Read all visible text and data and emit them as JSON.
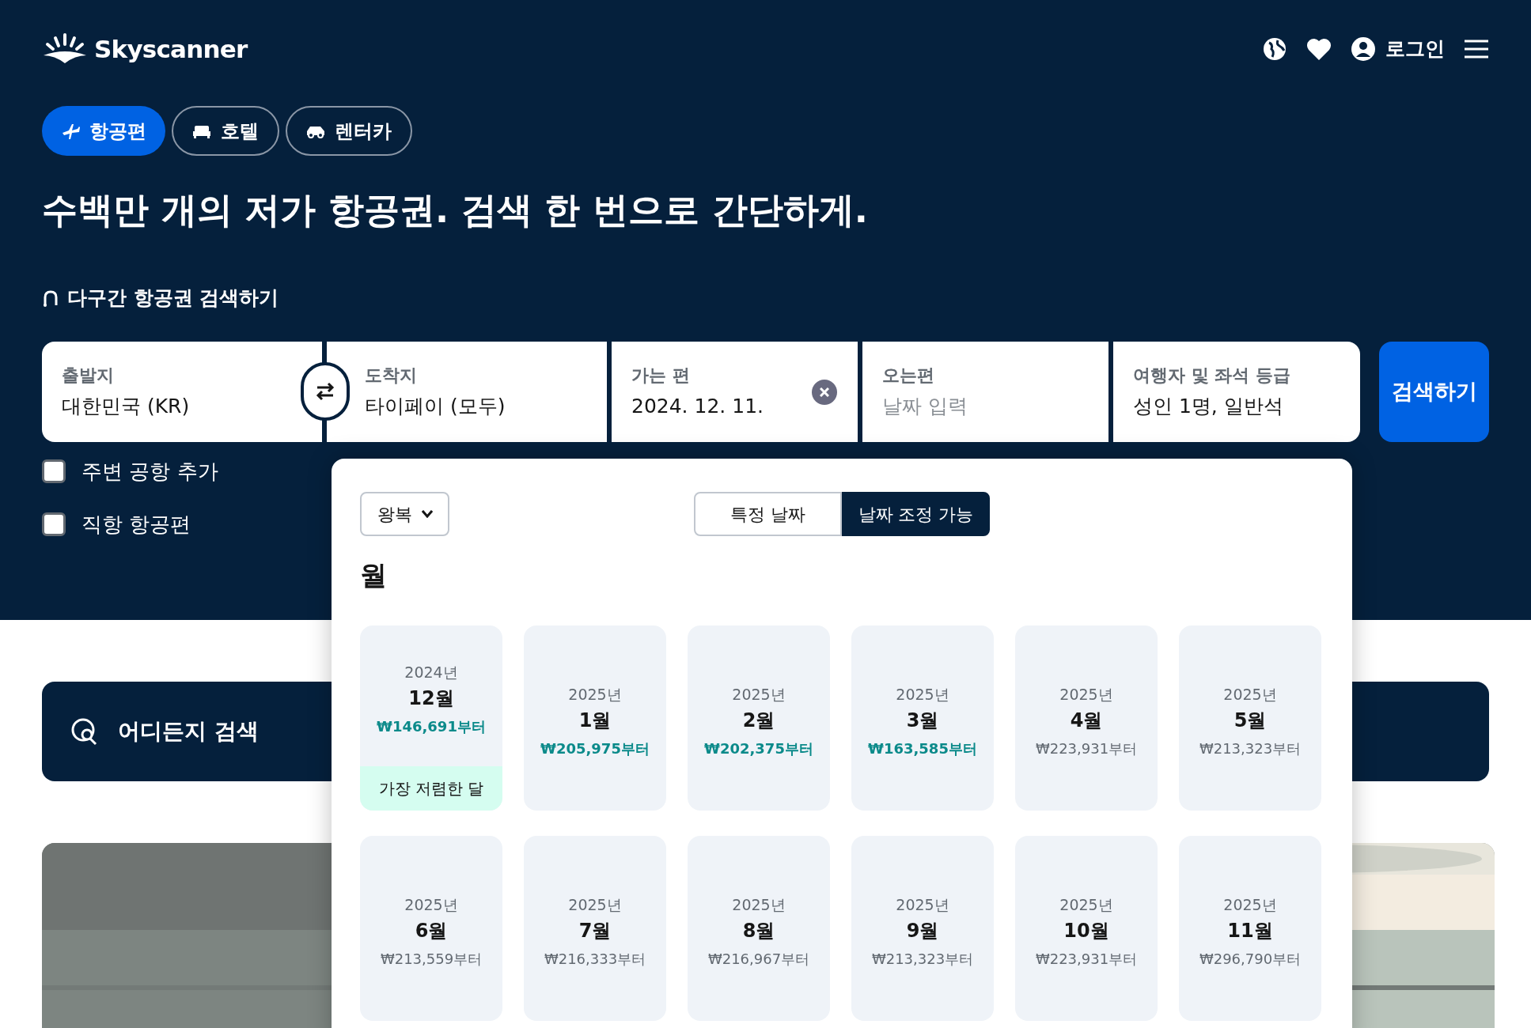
{
  "header": {
    "logo": "Skyscanner",
    "login": "로그인"
  },
  "tabs": [
    {
      "label": "항공편",
      "kind": "flights",
      "selected": true
    },
    {
      "label": "호텔",
      "kind": "hotels",
      "selected": false
    },
    {
      "label": "렌터카",
      "kind": "cars",
      "selected": false
    }
  ],
  "headline": "수백만 개의 저가 항공권. 검색 한 번으로 간단하게.",
  "multi_city": "다구간 항공권 검색하기",
  "search": {
    "fields": [
      {
        "label": "출발지",
        "value": "대한민국 (KR)"
      },
      {
        "label": "도착지",
        "value": "타이페이 (모두)"
      },
      {
        "label": "가는 편",
        "value": "2024. 12. 11."
      },
      {
        "label": "오는편",
        "placeholder": "날짜 입력"
      },
      {
        "label": "여행자 및 좌석 등급",
        "value": "성인 1명, 일반석"
      }
    ],
    "button": "검색하기"
  },
  "options": [
    {
      "label": "주변 공항 추가",
      "checked": false
    },
    {
      "label": "직항 항공편",
      "checked": false
    }
  ],
  "anywhere": "어디든지 검색",
  "date_popup": {
    "trip_type": "왕복",
    "modes": [
      {
        "label": "특정 날짜",
        "selected": false
      },
      {
        "label": "날짜 조정 가능",
        "selected": true
      }
    ],
    "heading": "월",
    "months": [
      {
        "year": "2024년",
        "month": "12월",
        "price": "₩146,691부터",
        "highlight": true,
        "badge": "가장 저렴한 달"
      },
      {
        "year": "2025년",
        "month": "1월",
        "price": "₩205,975부터",
        "highlight": true
      },
      {
        "year": "2025년",
        "month": "2월",
        "price": "₩202,375부터",
        "highlight": true
      },
      {
        "year": "2025년",
        "month": "3월",
        "price": "₩163,585부터",
        "highlight": true
      },
      {
        "year": "2025년",
        "month": "4월",
        "price": "₩223,931부터",
        "highlight": false
      },
      {
        "year": "2025년",
        "month": "5월",
        "price": "₩213,323부터",
        "highlight": false
      },
      {
        "year": "2025년",
        "month": "6월",
        "price": "₩213,559부터",
        "highlight": false
      },
      {
        "year": "2025년",
        "month": "7월",
        "price": "₩216,333부터",
        "highlight": false
      },
      {
        "year": "2025년",
        "month": "8월",
        "price": "₩216,967부터",
        "highlight": false
      },
      {
        "year": "2025년",
        "month": "9월",
        "price": "₩213,323부터",
        "highlight": false
      },
      {
        "year": "2025년",
        "month": "10월",
        "price": "₩223,931부터",
        "highlight": false
      },
      {
        "year": "2025년",
        "month": "11월",
        "price": "₩296,790부터",
        "highlight": false
      }
    ]
  }
}
